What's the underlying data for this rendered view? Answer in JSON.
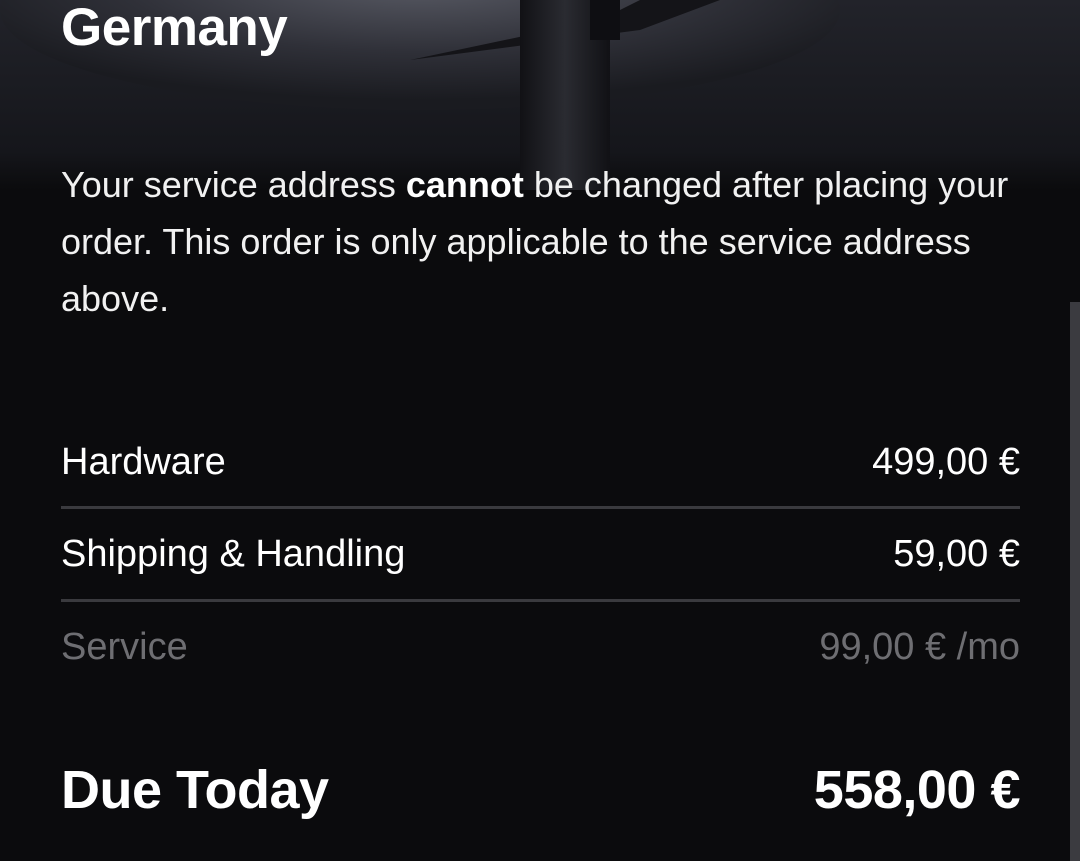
{
  "location": {
    "country": "Germany"
  },
  "notice": {
    "part1": "Your service address ",
    "emphasis": "cannot",
    "part2": " be changed after placing your order. This order is only applicable to the service address above."
  },
  "summary": {
    "items": [
      {
        "label": "Hardware",
        "value": "499,00 €"
      },
      {
        "label": "Shipping & Handling",
        "value": "59,00 €"
      },
      {
        "label": "Service",
        "value": "99,00 € /mo"
      }
    ],
    "total": {
      "label": "Due Today",
      "value": "558,00 €"
    }
  },
  "colors": {
    "background": "#0b0b0d",
    "text": "#ffffff",
    "muted_text": "#6e6e72",
    "divider": "#3a3a3e"
  }
}
